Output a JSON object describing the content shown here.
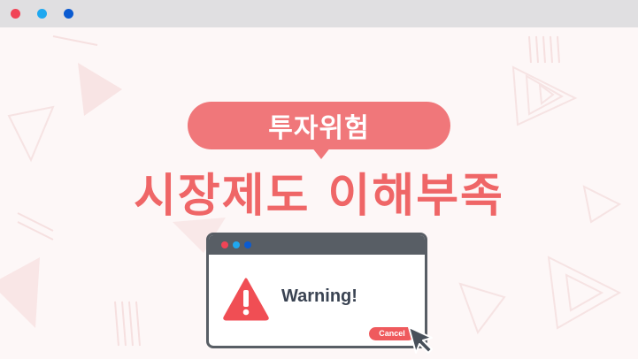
{
  "window": {
    "controls": [
      {
        "name": "close",
        "color": "#f14456"
      },
      {
        "name": "minimize",
        "color": "#1fa8f0"
      },
      {
        "name": "maximize",
        "color": "#0b5bd1"
      }
    ]
  },
  "bubble": {
    "label": "투자위험",
    "color": "#f0777a"
  },
  "headline": {
    "text": "시장제도 이해부족",
    "color": "#ef6667"
  },
  "dialog": {
    "message": "Warning!",
    "cancel_label": "Cancel",
    "icon": "warning-triangle-icon",
    "warning_color": "#f04e54"
  }
}
